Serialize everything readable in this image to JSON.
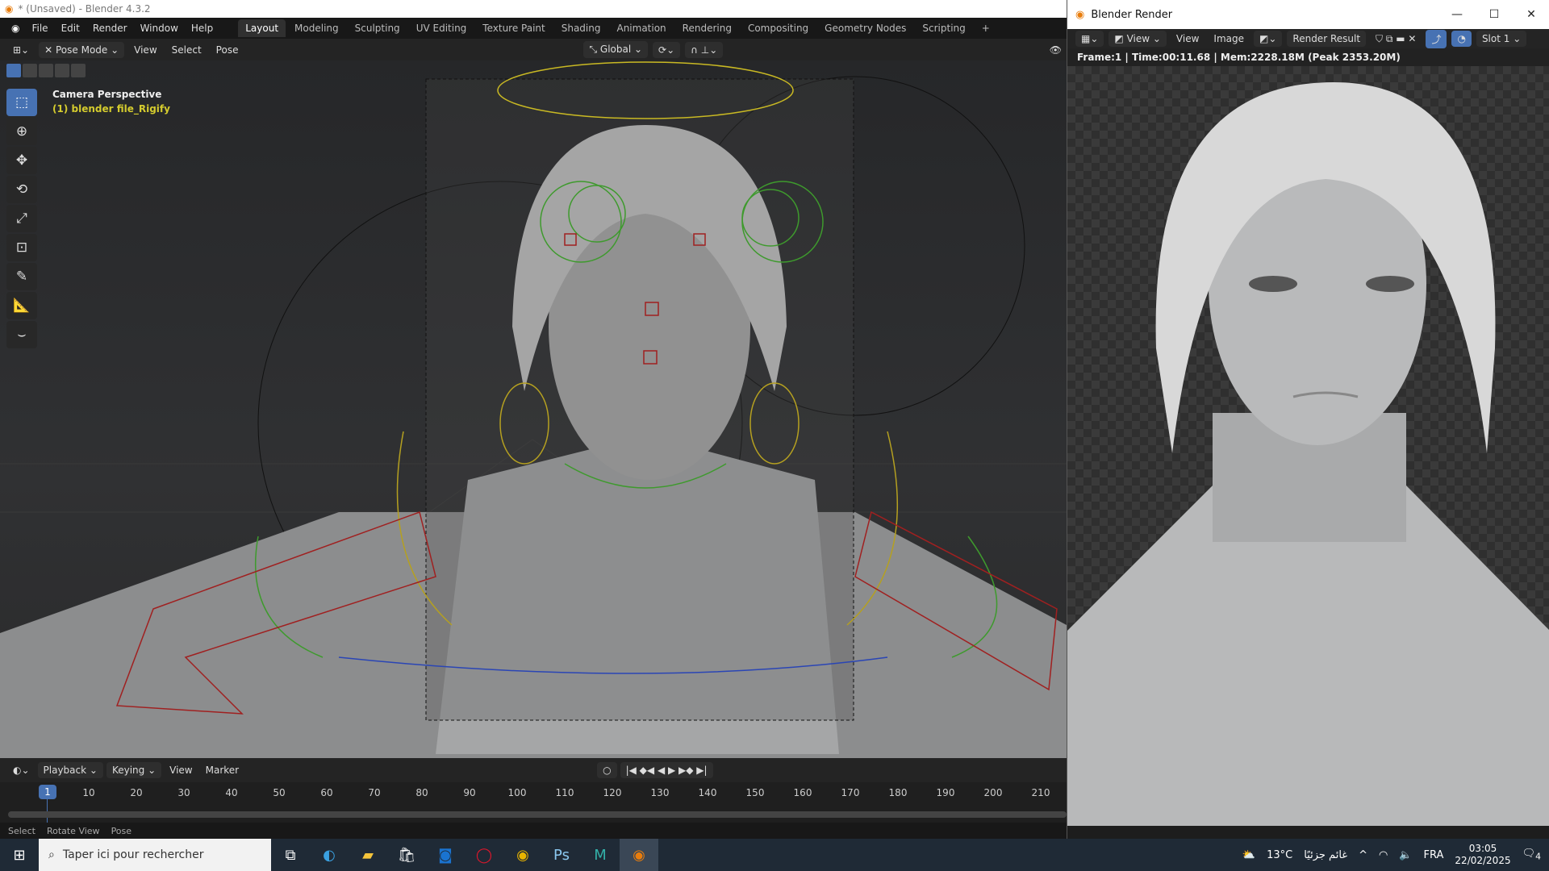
{
  "window": {
    "title": "* (Unsaved) - Blender 4.3.2"
  },
  "menu": [
    "File",
    "Edit",
    "Render",
    "Window",
    "Help"
  ],
  "workspaces": [
    "Layout",
    "Modeling",
    "Sculpting",
    "UV Editing",
    "Texture Paint",
    "Shading",
    "Animation",
    "Rendering",
    "Compositing",
    "Geometry Nodes",
    "Scripting"
  ],
  "header3d": {
    "mode": "Pose Mode",
    "items": [
      "View",
      "Select",
      "Pose"
    ],
    "orientation": "Global"
  },
  "viewport": {
    "overlay_title": "Camera Perspective",
    "overlay_object": "(1) blender file_Rigify",
    "tools": [
      "select-box",
      "cursor",
      "move",
      "rotate",
      "scale",
      "transform",
      "annotate",
      "measure",
      "pose-curve"
    ]
  },
  "timeline": {
    "menus": [
      "Playback",
      "Keying",
      "View",
      "Marker"
    ],
    "current_frame": "1",
    "ticks": [
      "10",
      "20",
      "30",
      "40",
      "50",
      "60",
      "70",
      "80",
      "90",
      "100",
      "110",
      "120",
      "130",
      "140",
      "150",
      "160",
      "170",
      "180",
      "190",
      "200",
      "210"
    ]
  },
  "statusbar": [
    "Select",
    "Rotate View",
    "Pose"
  ],
  "render_window": {
    "title": "Blender Render",
    "view_menu": "View",
    "menus": [
      "View",
      "Image"
    ],
    "image_name": "Render Result",
    "slot": "Slot 1",
    "info": "Frame:1 | Time:00:11.68 | Mem:2228.18M (Peak 2353.20M)"
  },
  "taskbar": {
    "search_placeholder": "Taper ici pour rechercher",
    "weather": "13°C",
    "weather_text": "غائم جزئيًا",
    "language": "FRA",
    "time": "03:05",
    "date": "22/02/2025",
    "notifications": "4"
  },
  "colors": {
    "accent": "#4772b3",
    "object_name": "#d4cb2e"
  }
}
